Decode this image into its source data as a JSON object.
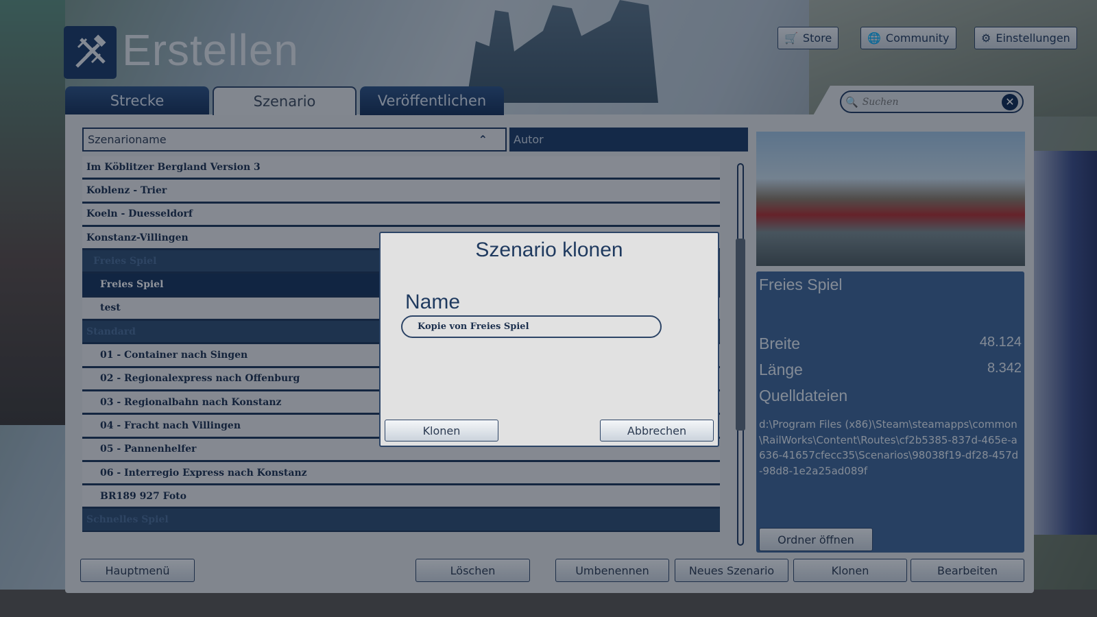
{
  "header": {
    "title": "Erstellen",
    "logo_icon": "hammer-track-icon"
  },
  "top_buttons": [
    {
      "label": "Store",
      "icon": "cart-icon"
    },
    {
      "label": "Community",
      "icon": "globe-icon"
    },
    {
      "label": "Einstellungen",
      "icon": "gear-icon"
    }
  ],
  "tabs": [
    {
      "label": "Strecke"
    },
    {
      "label": "Szenario",
      "active": true
    },
    {
      "label": "Veröffentlichen"
    }
  ],
  "search": {
    "placeholder": "Suchen"
  },
  "columns": {
    "name": "Szenarioname",
    "author": "Autor"
  },
  "rows": [
    {
      "label": "Im Köblitzer Bergland Version 3",
      "type": "route"
    },
    {
      "label": "Koblenz - Trier",
      "type": "route"
    },
    {
      "label": "Koeln - Duesseldorf",
      "type": "route"
    },
    {
      "label": "Konstanz-Villingen",
      "type": "route"
    },
    {
      "label": "Freies Spiel",
      "type": "group"
    },
    {
      "label": "Freies Spiel",
      "type": "selected"
    },
    {
      "label": "test",
      "type": "item"
    },
    {
      "label": "Standard",
      "type": "group0"
    },
    {
      "label": "01 - Container nach Singen",
      "type": "item"
    },
    {
      "label": "02 - Regionalexpress nach Offenburg",
      "type": "item"
    },
    {
      "label": "03 - Regionalbahn nach Konstanz",
      "type": "item"
    },
    {
      "label": "04 - Fracht nach Villingen",
      "type": "item"
    },
    {
      "label": "05 - Pannenhelfer",
      "type": "item"
    },
    {
      "label": "06 - Interregio Express nach Konstanz",
      "type": "item"
    },
    {
      "label": "BR189 927 Foto",
      "type": "item"
    },
    {
      "label": "Schnelles Spiel",
      "type": "group0"
    }
  ],
  "details": {
    "title": "Freies Spiel",
    "width_label": "Breite",
    "width_value": "48.124",
    "length_label": "Länge",
    "length_value": "8.342",
    "source_label": "Quelldateien",
    "source_path": "d:\\Program Files (x86)\\Steam\\steamapps\\common\\RailWorks\\Content\\Routes\\cf2b5385-837d-465e-a636-41657cfecc35\\Scenarios\\98038f19-df28-457d-98d8-1e2a25ad089f",
    "open_folder": "Ordner öffnen"
  },
  "bottom_buttons": {
    "main_menu": "Hauptmenü",
    "delete": "Löschen",
    "rename": "Umbenennen",
    "new": "Neues Szenario",
    "clone": "Klonen",
    "edit": "Bearbeiten"
  },
  "dialog": {
    "title": "Szenario klonen",
    "name_label": "Name",
    "name_value": "Kopie von Freies Spiel",
    "confirm": "Klonen",
    "cancel": "Abbrechen"
  }
}
